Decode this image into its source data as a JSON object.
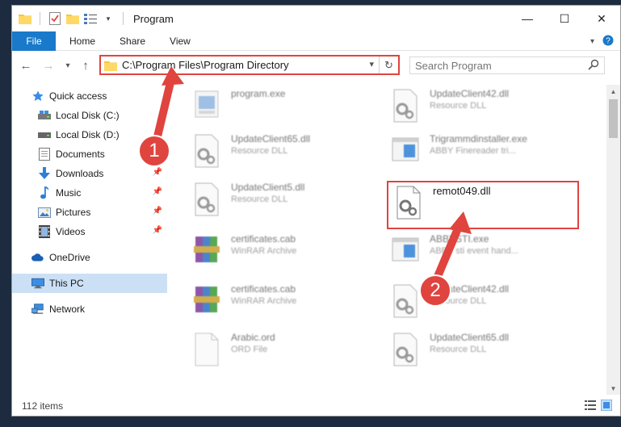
{
  "window": {
    "title": "Program",
    "controls": {
      "minimize": "—",
      "maximize": "☐",
      "close": "✕"
    }
  },
  "ribbon": {
    "file_label": "File",
    "tabs": [
      "Home",
      "Share",
      "View"
    ]
  },
  "navigation": {
    "back_icon": "arrow-left-icon",
    "forward_icon": "arrow-right-icon",
    "up_icon": "arrow-up-icon",
    "address_path": "C:\\Program Files\\Program Directory",
    "search_placeholder": "Search Program"
  },
  "sidebar": {
    "items": [
      {
        "label": "Quick access",
        "icon": "star-icon",
        "pinned": false
      },
      {
        "label": "Local Disk (C:)",
        "icon": "drive-icon",
        "pinned": false
      },
      {
        "label": "Local Disk (D:)",
        "icon": "drive-icon",
        "pinned": false
      },
      {
        "label": "Documents",
        "icon": "documents-icon",
        "pinned": false
      },
      {
        "label": "Downloads",
        "icon": "download-icon",
        "pinned": true
      },
      {
        "label": "Music",
        "icon": "music-icon",
        "pinned": true
      },
      {
        "label": "Pictures",
        "icon": "pictures-icon",
        "pinned": true
      },
      {
        "label": "Videos",
        "icon": "videos-icon",
        "pinned": true
      },
      {
        "label": "OneDrive",
        "icon": "cloud-icon",
        "pinned": false
      },
      {
        "label": "This PC",
        "icon": "computer-icon",
        "pinned": false,
        "selected": true
      },
      {
        "label": "Network",
        "icon": "network-icon",
        "pinned": false
      }
    ]
  },
  "files": [
    {
      "name": "program.exe",
      "desc": "",
      "icon": "exe-icon"
    },
    {
      "name": "UpdateClient42.dll",
      "desc": "Resource DLL",
      "icon": "dll-icon"
    },
    {
      "name": "UpdateClient65.dll",
      "desc": "Resource DLL",
      "icon": "dll-icon"
    },
    {
      "name": "Trigrammdinstaller.exe",
      "desc": "ABBY Finereader tri...",
      "icon": "app-icon"
    },
    {
      "name": "UpdateClient5.dll",
      "desc": "Resource DLL",
      "icon": "dll-icon"
    },
    {
      "name": "remot049.dll",
      "desc": "",
      "icon": "dll-icon"
    },
    {
      "name": "certificates.cab",
      "desc": "WinRAR Archive",
      "icon": "archive-icon"
    },
    {
      "name": "ABBYSTI.exe",
      "desc": "ABBY sti event hand...",
      "icon": "app-icon"
    },
    {
      "name": "certificates.cab",
      "desc": "WinRAR Archive",
      "icon": "archive-icon"
    },
    {
      "name": "UpdateClient42.dll",
      "desc": "Resource DLL",
      "icon": "dll-icon"
    },
    {
      "name": "Arabic.ord",
      "desc": "ORD File",
      "icon": "generic-file-icon"
    },
    {
      "name": "UpdateClient65.dll",
      "desc": "Resource DLL",
      "icon": "dll-icon"
    }
  ],
  "status": {
    "item_count": "112 items"
  },
  "callouts": [
    "1",
    "2"
  ],
  "colors": {
    "accent": "#1979ca",
    "highlight": "#e0443e",
    "selection": "#cce0f5"
  }
}
